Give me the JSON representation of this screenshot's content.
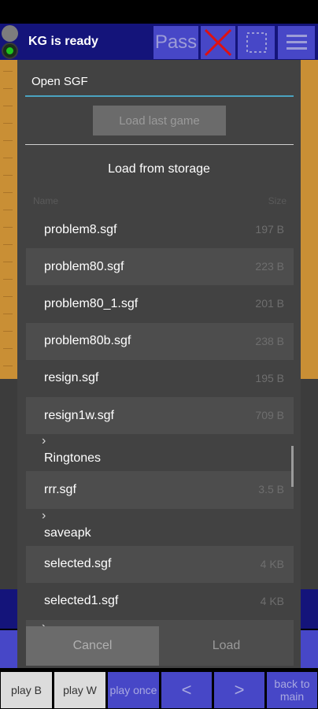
{
  "toolbar": {
    "status": "KG is ready",
    "pass_label": "Pass",
    "icons": [
      "cancel-x-icon",
      "selection-icon",
      "menu-icon"
    ],
    "accent": "#4747c7",
    "x_color": "#e01010"
  },
  "dialog": {
    "title": "Open SGF",
    "load_last": "Load last game",
    "storage_label": "Load from storage",
    "columns": {
      "name": "Name",
      "size": "Size"
    },
    "files": [
      {
        "name": "problem8.sgf",
        "size": "197 B"
      },
      {
        "name": "problem80.sgf",
        "size": "223 B"
      },
      {
        "name": "problem80_1.sgf",
        "size": "201 B"
      },
      {
        "name": "problem80b.sgf",
        "size": "238 B"
      },
      {
        "name": "resign.sgf",
        "size": "195 B"
      },
      {
        "name": "resign1w.sgf",
        "size": "709 B"
      },
      {
        "name": "Ringtones",
        "size": "",
        "folder": true
      },
      {
        "name": "rrr.sgf",
        "size": "3.5 B"
      },
      {
        "name": "saveapk",
        "size": "",
        "folder": true
      },
      {
        "name": "selected.sgf",
        "size": "4 KB"
      },
      {
        "name": "selected1.sgf",
        "size": "4 KB"
      },
      {
        "name": "",
        "size": "",
        "folder": true
      }
    ],
    "cancel": "Cancel",
    "load": "Load"
  },
  "bottom_bar": {
    "play_b": "play B",
    "play_w": "play W",
    "play_once": "play once",
    "prev": "<",
    "next": ">",
    "back": "back to main"
  }
}
